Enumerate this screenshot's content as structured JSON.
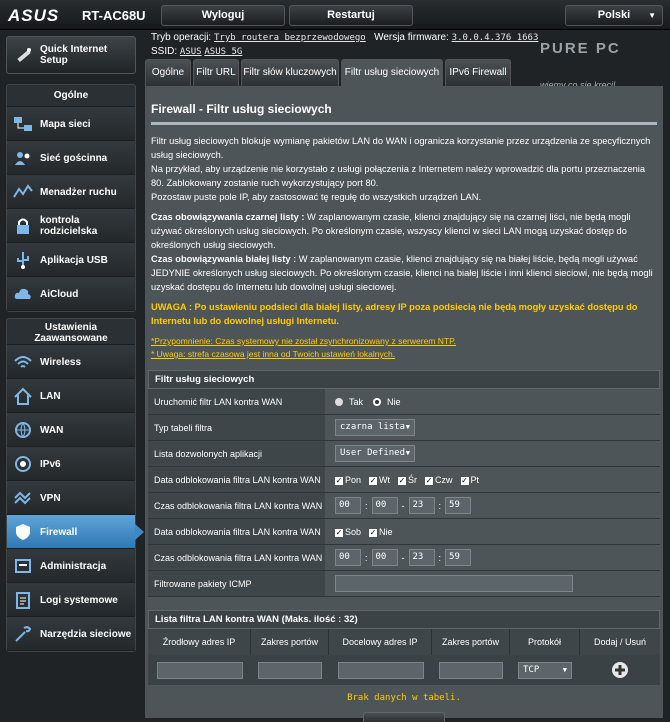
{
  "header": {
    "brand": "ASUS",
    "model": "RT-AC68U",
    "logout_label": "Wyloguj",
    "restart_label": "Restartuj",
    "language": "Polski",
    "op_mode_label": "Tryb operacji:",
    "op_mode_value": "Tryb routera bezprzewodowego",
    "firmware_label": "Wersja firmware:",
    "firmware_value": "3.0.0.4.376_1663",
    "ssid_label": "SSID:",
    "ssid1": "ASUS",
    "ssid2": "ASUS_5G"
  },
  "watermark": {
    "line1": "PURE PC",
    "line2": "wiemy co się kręci!"
  },
  "sidebar": {
    "quick_setup": "Quick Internet Setup",
    "general_header": "Ogólne",
    "general": [
      {
        "label": "Mapa sieci",
        "icon": "network-map-icon"
      },
      {
        "label": "Sieć gościnna",
        "icon": "guest-network-icon"
      },
      {
        "label": "Menadżer ruchu",
        "icon": "traffic-manager-icon"
      },
      {
        "label": "kontrola rodzicielska",
        "icon": "parental-control-icon"
      },
      {
        "label": "Aplikacja USB",
        "icon": "usb-icon"
      },
      {
        "label": "AiCloud",
        "icon": "cloud-icon"
      }
    ],
    "advanced_header": "Ustawienia Zaawansowane",
    "advanced": [
      {
        "label": "Wireless",
        "icon": "wifi-icon"
      },
      {
        "label": "LAN",
        "icon": "home-icon"
      },
      {
        "label": "WAN",
        "icon": "globe-icon"
      },
      {
        "label": "IPv6",
        "icon": "ipv6-icon"
      },
      {
        "label": "VPN",
        "icon": "vpn-icon"
      },
      {
        "label": "Firewall",
        "icon": "shield-icon"
      },
      {
        "label": "Administracja",
        "icon": "admin-icon"
      },
      {
        "label": "Logi systemowe",
        "icon": "log-icon"
      },
      {
        "label": "Narzędzia sieciowe",
        "icon": "tools-icon"
      }
    ]
  },
  "tabs": [
    "Ogólne",
    "Filtr URL",
    "Filtr słów kluczowych",
    "Filtr usług sieciowych",
    "IPv6 Firewall"
  ],
  "main": {
    "title": "Firewall - Filtr usług sieciowych",
    "p1": "Filtr usług sieciowych blokuje wymianę pakietów LAN do WAN i ogranicza korzystanie przez urządzenia ze specyficznych usług sieciowych.",
    "p2": "Na przykład, aby urządzenie nie korzystało z usługi połączenia z Internetem należy wprowadzić dla portu przeznaczenia 80. Zablokowany zostanie ruch wykorzystujący port 80.",
    "p3": "Pozostaw puste pole IP, aby zastosować tę regułę do wszystkich urządzeń LAN.",
    "black_label": "Czas obowiązywania czarnej listy :",
    "black_text": " W zaplanowanym czasie, klienci znajdujący się na czarnej liści, nie będą mogli używać określonych usług sieciowych. Po określonym czasie, wszyscy klienci w sieci LAN mogą uzyskać dostęp do określonych usług sieciowych.",
    "white_label": "Czas obowiązywania białej listy :",
    "white_text": " W zaplanowanym czasie, klienci znajdujący się na białej liście, będą mogli używać JEDYNIE określonych usług sieciowych. Po określonym czasie, klienci na białej liście i inni klienci sieciowi, nie będą mogli uzyskać dostępu do Internetu lub dowolnej usługi sieciowej.",
    "warning": "UWAGA : Po ustawieniu podsieci dla białej listy, adresy IP poza podsiecią nie będą mogły uzyskać dostępu do Internetu lub do dowolnej usługi Internetu.",
    "note1": "*Przypomnienie: Czas systemowy nie został zsynchronizowany z serwerem NTP.",
    "note2": "* Uwaga: strefa czasowa jest inna od Twoich ustawień lokalnych."
  },
  "filter": {
    "header": "Filtr usług sieciowych",
    "enable_label": "Uruchomić filtr LAN kontra WAN",
    "yes": "Tak",
    "no": "Nie",
    "table_type_label": "Typ tabeli filtra",
    "table_type_value": "czarna lista",
    "apps_label": "Lista dozwolonych aplikacji",
    "apps_value": "User Defined",
    "date1_label": "Data odblokowania filtra LAN kontra WAN",
    "days1": [
      "Pon",
      "Wt",
      "Śr",
      "Czw",
      "Pt"
    ],
    "time1_label": "Czas odblokowania filtra LAN kontra WAN",
    "time1": [
      "00",
      "00",
      "23",
      "59"
    ],
    "date2_label": "Data odblokowania filtra LAN kontra WAN",
    "days2": [
      "Sob",
      "Nie"
    ],
    "time2_label": "Czas odblokowania filtra LAN kontra WAN",
    "time2": [
      "00",
      "00",
      "23",
      "59"
    ],
    "icmp_label": "Filtrowane pakiety ICMP",
    "icmp_value": ""
  },
  "list": {
    "header": "Lista filtra LAN kontra WAN (Maks. ilość : 32)",
    "columns": [
      "Źrodłowy adres IP",
      "Zakres portów",
      "Docelowy adres IP",
      "Zakres portów",
      "Protokół",
      "Dodaj / Usuń"
    ],
    "protocol": "TCP",
    "empty": "Brak danych w tabeli."
  },
  "colors": {
    "accent": "#3f8ac3",
    "warning": "#ffcc00"
  }
}
